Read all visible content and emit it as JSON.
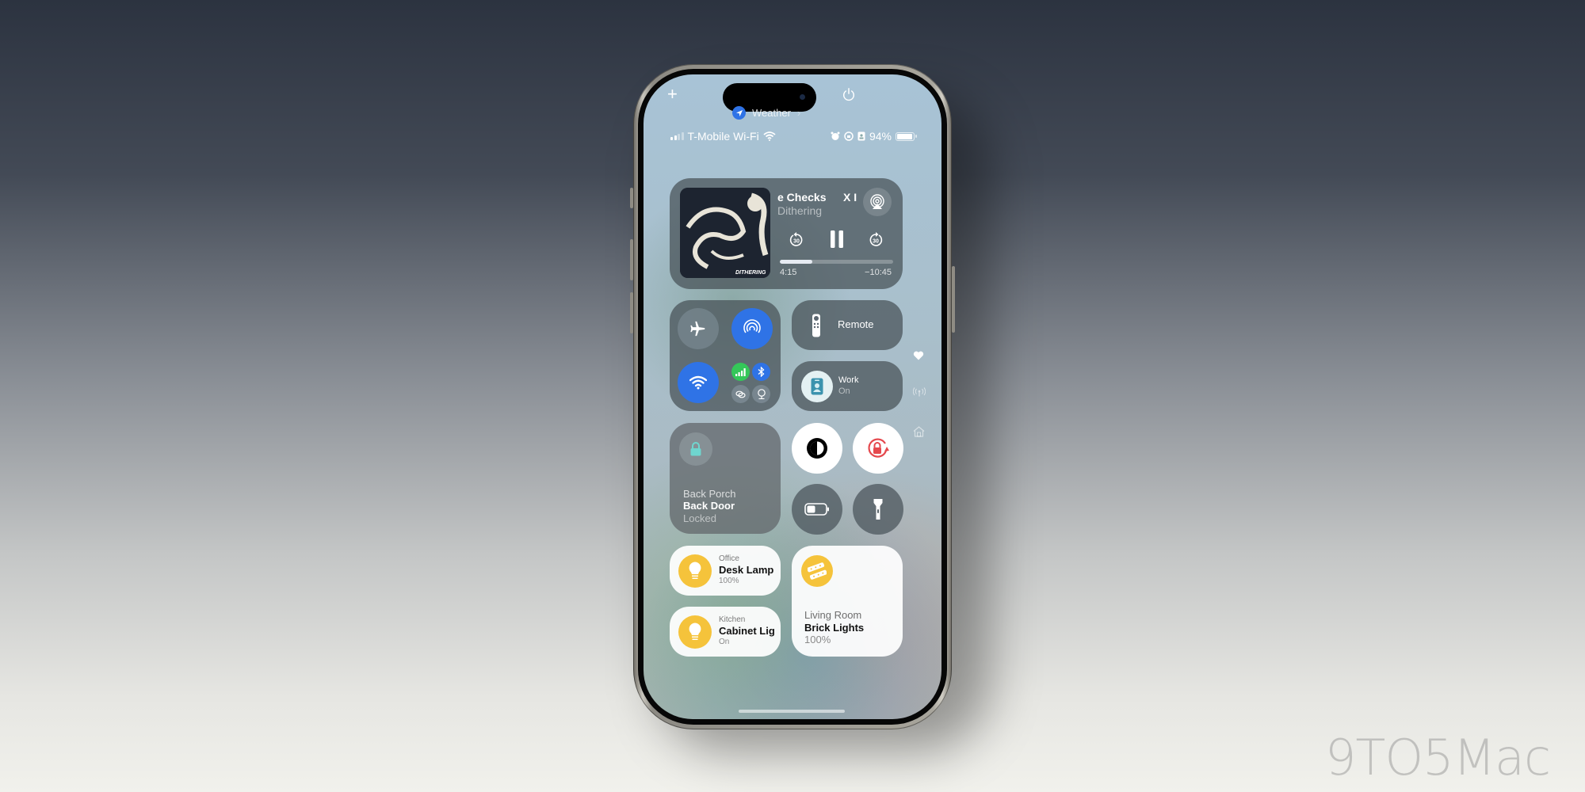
{
  "header": {
    "add_icon": "plus-icon",
    "power_icon": "power-icon",
    "focus_app": {
      "label": "Weather",
      "icon": "location-arrow-icon",
      "chevron": "chevron-right-icon"
    }
  },
  "status_bar": {
    "carrier": "T-Mobile Wi-Fi",
    "signal_bars": 2,
    "battery_percent": "94%",
    "battery_level": 0.94,
    "icons": [
      "alarm-icon",
      "orientation-lock-icon",
      "focus-badge-icon"
    ]
  },
  "now_playing": {
    "title_visible": "e Checks",
    "title_tail": "X I",
    "artist": "Dithering",
    "album_art_label": "DITHERING",
    "elapsed": "4:15",
    "remaining": "−10:45",
    "progress": 0.29,
    "skip_back_seconds": "30",
    "skip_forward_seconds": "30"
  },
  "connectivity": {
    "airplane": {
      "active": false
    },
    "airdrop": {
      "active": true
    },
    "wifi": {
      "active": true
    },
    "cellular": {
      "active": true
    },
    "bluetooth": {
      "active": true
    },
    "personal_hotspot": {
      "active": false
    },
    "vpn": {
      "active": false
    },
    "accent_blue": "#2f73e6",
    "accent_green": "#34c759"
  },
  "remote": {
    "label": "Remote"
  },
  "focus": {
    "label": "Work",
    "status": "On"
  },
  "door_lock": {
    "room": "Back Porch",
    "name": "Back Door",
    "status": "Locked",
    "accent": "#6fd6cf"
  },
  "toggles": {
    "dark_mode": "dark-mode-icon",
    "orientation_lock": "orientation-lock-icon",
    "low_power": "low-power-battery-icon",
    "flashlight": "flashlight-icon",
    "lock_red": "#e5484d"
  },
  "lights": [
    {
      "room": "Office",
      "name": "Desk Lamp",
      "status": "100%"
    },
    {
      "room": "Kitchen",
      "name": "Cabinet Lig",
      "status": "On"
    },
    {
      "room": "Living Room",
      "name": "Brick Lights",
      "status": "100%"
    }
  ],
  "light_accent": "#f5c33b",
  "page_indicators": [
    "favorites-heart-icon",
    "connectivity-antenna-icon",
    "home-icon"
  ],
  "watermark": "9TO5Mac"
}
